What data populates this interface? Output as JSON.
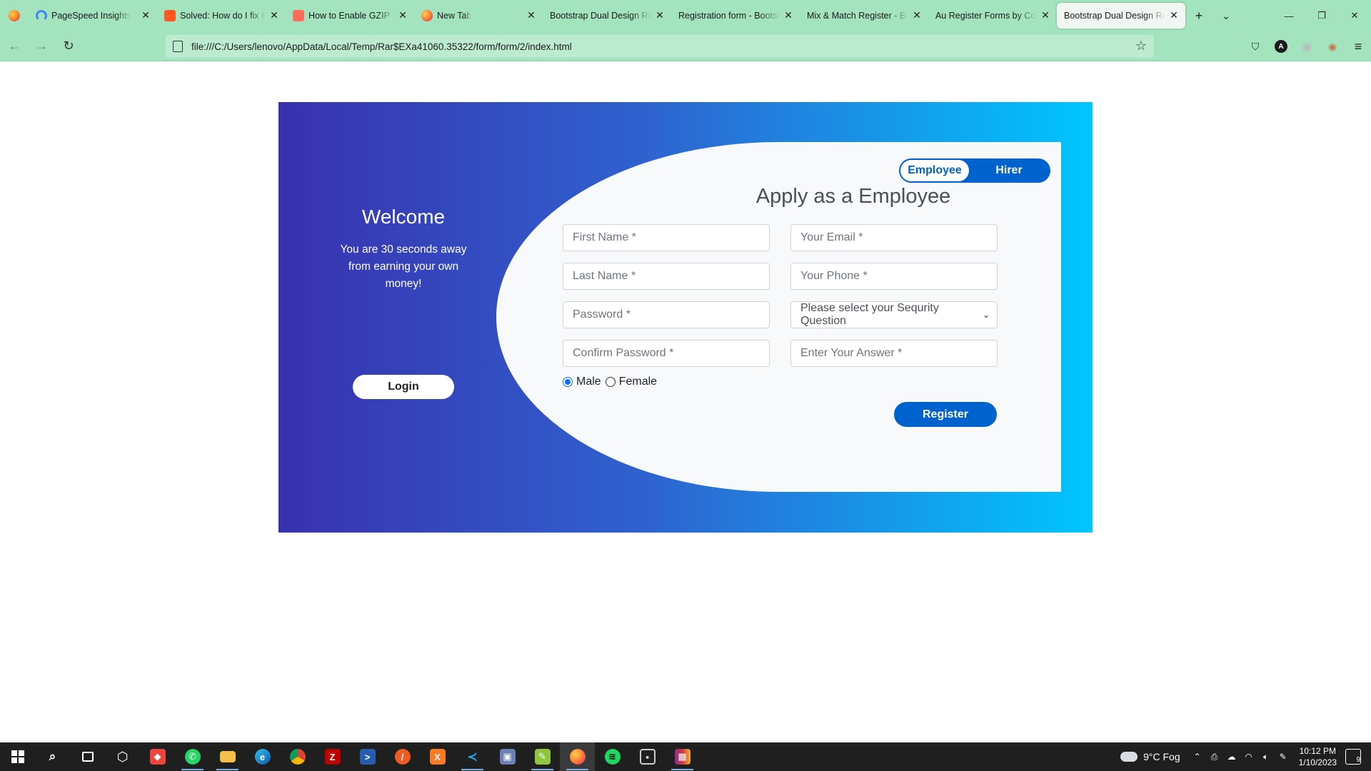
{
  "browser": {
    "tabs": [
      {
        "title": "PageSpeed Insights",
        "icon": "pagespeed-icon",
        "color": "#4285f4"
      },
      {
        "title": "Solved: How do I fix Pa",
        "icon": "solved-icon",
        "color": "#ff5722"
      },
      {
        "title": "How to Enable GZIP Co",
        "icon": "gzip-icon",
        "color": "#ff6d5a"
      },
      {
        "title": "New Tab",
        "icon": "firefox-icon",
        "color": "#ff7139"
      },
      {
        "title": "Bootstrap Dual Design Reg",
        "icon": "",
        "color": ""
      },
      {
        "title": "Registration form - Bootsni",
        "icon": "",
        "color": ""
      },
      {
        "title": "Mix & Match Register - Boo",
        "icon": "",
        "color": ""
      },
      {
        "title": "Au Register Forms by Colo",
        "icon": "",
        "color": ""
      },
      {
        "title": "Bootstrap Dual Design Reg",
        "icon": "",
        "color": "",
        "active": true
      }
    ],
    "url": "file:///C:/Users/lenovo/AppData/Local/Temp/Rar$EXa41060.35322/form/form/2/index.html",
    "chrome_color": "#a3e3bd"
  },
  "page": {
    "left": {
      "title": "Welcome",
      "text": "You are 30 seconds away from earning your own money!",
      "login_label": "Login"
    },
    "toggle": {
      "employee": "Employee",
      "hirer": "Hirer",
      "selected": "Employee"
    },
    "heading": "Apply as a Employee",
    "fields": {
      "first_name": "First Name *",
      "last_name": "Last Name *",
      "password": "Password *",
      "confirm_password": "Confirm Password *",
      "email": "Your Email *",
      "phone": "Your Phone *",
      "security_question": "Please select your Sequrity Question",
      "answer": "Enter Your Answer *"
    },
    "gender": {
      "male": "Male",
      "female": "Female",
      "selected": "Male"
    },
    "register_label": "Register",
    "colors": {
      "gradient_start": "#3931af",
      "gradient_end": "#00c6ff",
      "primary": "#0062cc"
    }
  },
  "taskbar": {
    "weather": "9°C  Fog",
    "time": "10:12 PM",
    "date": "1/10/2023",
    "notifications": "9"
  }
}
